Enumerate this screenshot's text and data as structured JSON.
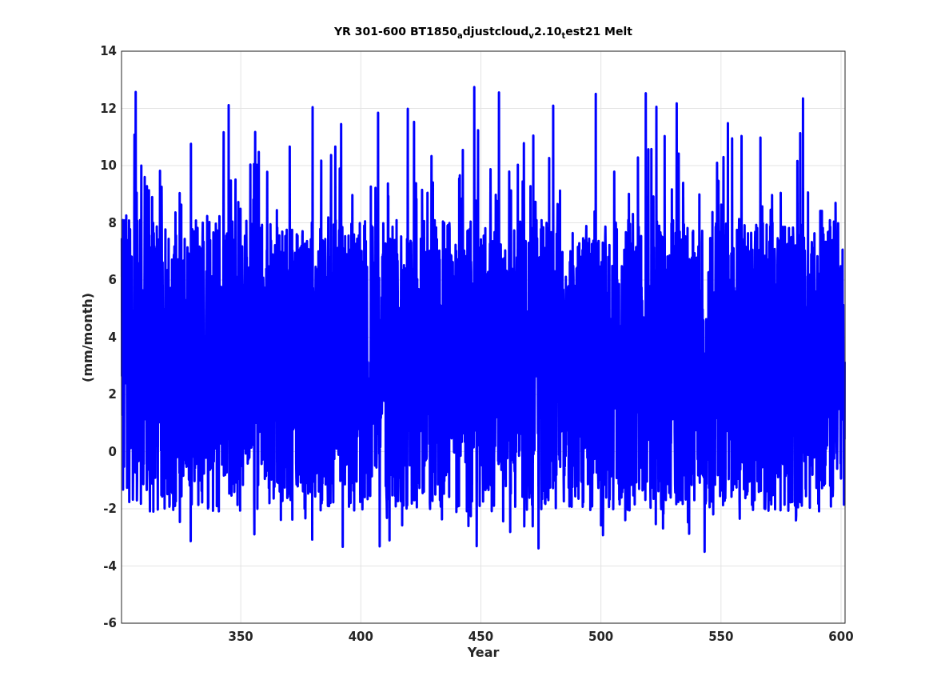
{
  "figure": {
    "title": "YR 301-600 BT1850$_{a}$djustcloud$_{v}$2.10$_{t}$est21 Melt",
    "ylabel": "(mm/month)",
    "xlabel": "Year",
    "xticks": [
      "350",
      "400",
      "450",
      "500",
      "550",
      "600"
    ],
    "yticks": [
      "14",
      "12",
      "10",
      "8",
      "6",
      "4",
      "2",
      "0",
      "-2",
      "-4",
      "-6"
    ]
  }
}
